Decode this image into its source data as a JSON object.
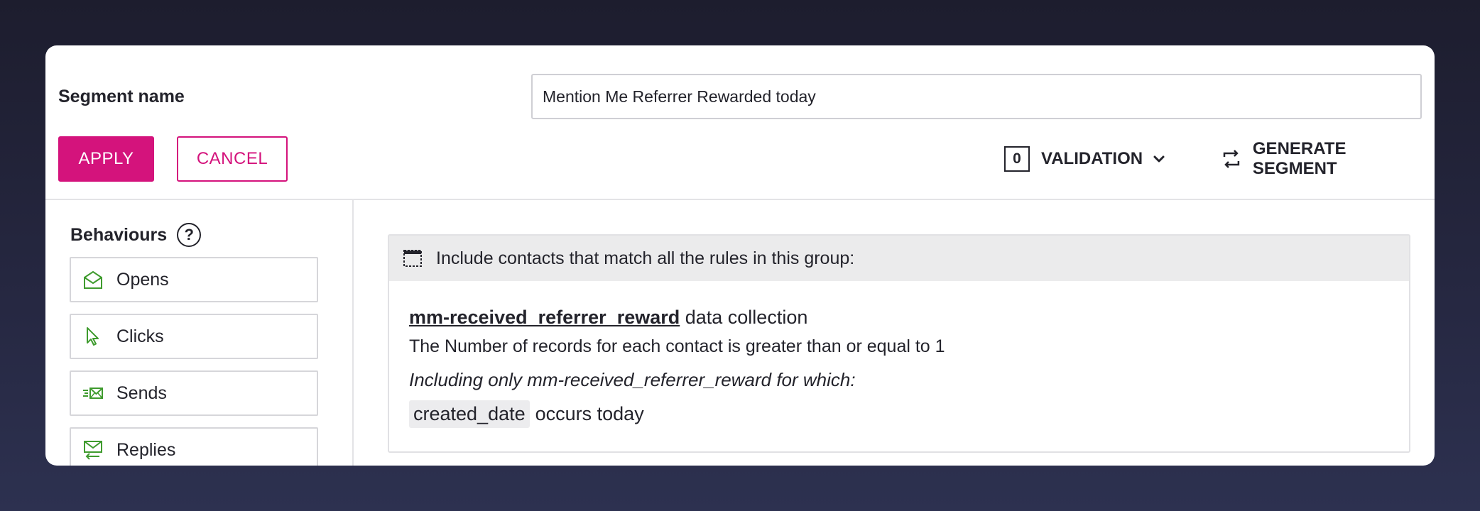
{
  "segment": {
    "label": "Segment name",
    "value": "Mention Me Referrer Rewarded today"
  },
  "actions": {
    "apply_label": "APPLY",
    "cancel_label": "CANCEL",
    "validation_count": "0",
    "validation_label": "VALIDATION",
    "generate_label": "GENERATE SEGMENT"
  },
  "behaviours": {
    "title": "Behaviours",
    "help_symbol": "?",
    "items": [
      {
        "label": "Opens",
        "icon": "envelope-open-icon"
      },
      {
        "label": "Clicks",
        "icon": "cursor-icon"
      },
      {
        "label": "Sends",
        "icon": "send-envelope-icon"
      },
      {
        "label": "Replies",
        "icon": "reply-envelope-icon"
      }
    ]
  },
  "group": {
    "header": "Include contacts that match all the rules in this group:",
    "rule": {
      "collection_link": "mm-received_referrer_reward",
      "collection_suffix": " data collection",
      "condition": "The Number of records for each contact is greater than or equal to 1",
      "including": "Including only mm-received_referrer_reward for which:",
      "field": "created_date",
      "field_condition": "occurs today"
    }
  },
  "colors": {
    "accent": "#d4137c",
    "icon_green": "#3f9b2e",
    "background": "#22243a"
  }
}
